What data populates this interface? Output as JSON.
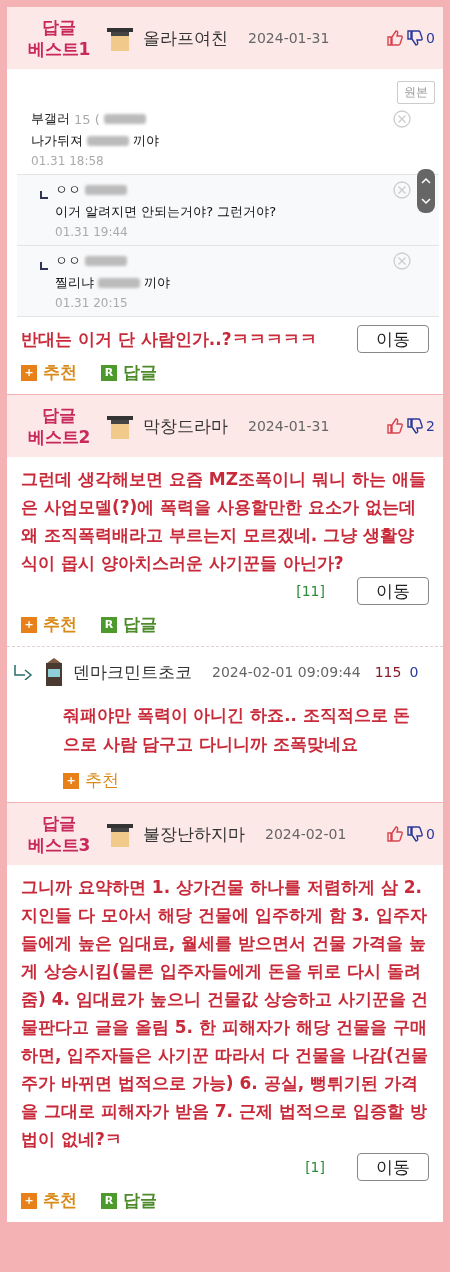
{
  "posts": [
    {
      "badge_top": "답글",
      "badge_bottom": "베스트1",
      "author": "올라프여친",
      "date": "2024-01-31",
      "down_count": "0",
      "embed": {
        "original_button": "원본",
        "comments": [
          {
            "nested": false,
            "author": "부갤러",
            "meta": "15 (",
            "text_before": "나가뒤져",
            "text_after": "끼야",
            "time": "01.31 18:58"
          },
          {
            "nested": true,
            "author": "ㅇㅇ",
            "text_before": "이거 알려지면 안되는거야? 그런거야?",
            "time": "01.31 19:44"
          },
          {
            "nested": true,
            "author": "ㅇㅇ",
            "text_before": "찔리냐",
            "text_after": "끼야",
            "time": "01.31 20:15"
          }
        ]
      },
      "body": "반대는 이거 단 사람인가..?ㅋㅋㅋㅋㅋ",
      "move_button": "이동",
      "actions": [
        {
          "kind": "recommend",
          "icon": "+",
          "label": "추천"
        },
        {
          "kind": "reply",
          "icon": "R",
          "label": "답글"
        }
      ]
    },
    {
      "badge_top": "답글",
      "badge_bottom": "베스트2",
      "author": "막창드라마",
      "date": "2024-01-31",
      "down_count": "2",
      "body": "그런데 생각해보면 요즘 MZ조폭이니 뭐니 하는 애들은 사업모델(?)에 폭력을 사용할만한 요소가 없는데 왜 조직폭력배라고 부르는지 모르겠네. 그냥 생활양식이 몹시 양아치스러운 사기꾼들 아닌가?",
      "ref": "[11]",
      "move_button": "이동",
      "actions": [
        {
          "kind": "recommend",
          "icon": "+",
          "label": "추천"
        },
        {
          "kind": "reply",
          "icon": "R",
          "label": "답글"
        }
      ],
      "replies": [
        {
          "author": "덴마크민트초코",
          "date": "2024-02-01 09:09:44",
          "up_count": "115",
          "down_count": "0",
          "body": "줘패야만 폭력이 아니긴 하죠.. 조직적으로 돈으로 사람 담구고 다니니까 조폭맞네요",
          "actions": [
            {
              "kind": "recommend",
              "icon": "+",
              "label": "추천"
            }
          ]
        }
      ]
    },
    {
      "badge_top": "답글",
      "badge_bottom": "베스트3",
      "author": "불장난하지마",
      "date": "2024-02-01",
      "down_count": "0",
      "body": "그니까 요약하면 1. 상가건물 하나를 저렴하게 삼 2. 지인들 다 모아서 해당 건물에 입주하게 함 3. 입주자들에게 높은 임대료, 월세를 받으면서 건물 가격을 높게 상승시킴(물론 입주자들에게 돈을 뒤로 다시 돌려줌) 4. 임대료가 높으니 건물값 상승하고 사기꾼을 건물판다고 글을 올림 5. 한 피해자가 해당 건물을 구매하면, 입주자들은 사기꾼 따라서 다 건물을 나감(건물주가 바뀌면 법적으로 가능) 6. 공실, 뻥튀기된 가격을 그대로 피해자가 받음 7. 근제 법적으로 입증할 방법이 없네?ㅋ",
      "ref": "[1]",
      "move_button": "이동",
      "actions": [
        {
          "kind": "recommend",
          "icon": "+",
          "label": "추천"
        },
        {
          "kind": "reply",
          "icon": "R",
          "label": "답글"
        }
      ]
    }
  ]
}
